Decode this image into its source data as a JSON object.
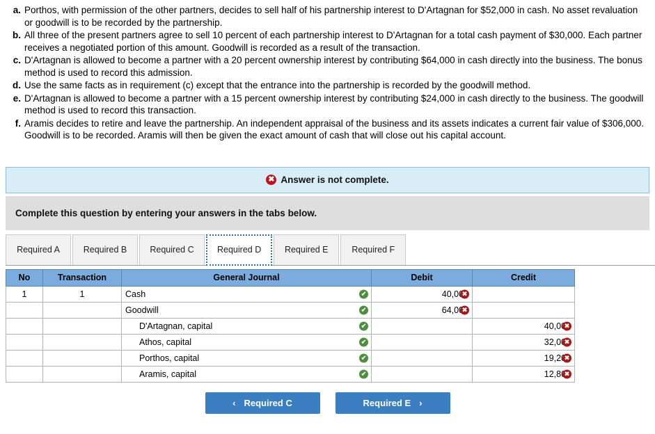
{
  "requirements": [
    {
      "letter": "a.",
      "text": "Porthos, with permission of the other partners, decides to sell half of his partnership interest to D'Artagnan for $52,000 in cash. No asset revaluation or goodwill is to be recorded by the partnership."
    },
    {
      "letter": "b.",
      "text": "All three of the present partners agree to sell 10 percent of each partnership interest to D'Artagnan for a total cash payment of $30,000. Each partner receives a negotiated portion of this amount. Goodwill is recorded as a result of the transaction."
    },
    {
      "letter": "c.",
      "text": "D'Artagnan is allowed to become a partner with a 20 percent ownership interest by contributing $64,000 in cash directly into the business. The bonus method is used to record this admission."
    },
    {
      "letter": "d.",
      "text": "Use the same facts as in requirement (c) except that the entrance into the partnership is recorded by the goodwill method."
    },
    {
      "letter": "e.",
      "text": "D'Artagnan is allowed to become a partner with a 15 percent ownership interest by contributing $24,000 in cash directly to the business. The goodwill method is used to record this transaction."
    },
    {
      "letter": "f.",
      "text": "Aramis decides to retire and leave the partnership. An independent appraisal of the business and its assets indicates a current fair value of $306,000. Goodwill is to be recorded. Aramis will then be given the exact amount of cash that will close out his capital account."
    }
  ],
  "alert": {
    "icon": "x-circle-icon",
    "message": "Answer is not complete.",
    "background_color": "#d9edf7",
    "border_color": "#8fbcd8",
    "icon_color": "#c10f1e"
  },
  "instructions": {
    "text": "Complete this question by entering your answers in the tabs below.",
    "background_color": "#dedede"
  },
  "tabs": [
    {
      "label": "Required A",
      "active": false
    },
    {
      "label": "Required B",
      "active": false
    },
    {
      "label": "Required C",
      "active": false
    },
    {
      "label": "Required D",
      "active": true
    },
    {
      "label": "Required E",
      "active": false
    },
    {
      "label": "Required F",
      "active": false
    }
  ],
  "journal": {
    "headers": {
      "no": "No",
      "transaction": "Transaction",
      "general_journal": "General Journal",
      "debit": "Debit",
      "credit": "Credit"
    },
    "header_background": "#7cacde",
    "rows": [
      {
        "no": "1",
        "transaction": "1",
        "account": "Cash",
        "indent": false,
        "account_mark": "check-icon",
        "debit": "40,000",
        "debit_mark": "x-icon",
        "credit": "",
        "credit_mark": ""
      },
      {
        "no": "",
        "transaction": "",
        "account": "Goodwill",
        "indent": false,
        "account_mark": "check-icon",
        "debit": "64,000",
        "debit_mark": "x-icon",
        "credit": "",
        "credit_mark": ""
      },
      {
        "no": "",
        "transaction": "",
        "account": "D'Artagnan, capital",
        "indent": true,
        "account_mark": "check-icon",
        "debit": "",
        "debit_mark": "",
        "credit": "40,000",
        "credit_mark": "x-icon"
      },
      {
        "no": "",
        "transaction": "",
        "account": "Athos, capital",
        "indent": true,
        "account_mark": "check-icon",
        "debit": "",
        "debit_mark": "",
        "credit": "32,000",
        "credit_mark": "x-icon"
      },
      {
        "no": "",
        "transaction": "",
        "account": "Porthos, capital",
        "indent": true,
        "account_mark": "check-icon",
        "debit": "",
        "debit_mark": "",
        "credit": "19,200",
        "credit_mark": "x-icon"
      },
      {
        "no": "",
        "transaction": "",
        "account": "Aramis, capital",
        "indent": true,
        "account_mark": "check-icon",
        "debit": "",
        "debit_mark": "",
        "credit": "12,800",
        "credit_mark": "x-icon"
      }
    ]
  },
  "navigation": {
    "prev_label": "Required C",
    "prev_chevron": "‹",
    "next_label": "Required E",
    "next_chevron": "›",
    "button_color": "#3b7ec2"
  },
  "glyphs": {
    "check": "✔",
    "cross": "✖"
  }
}
